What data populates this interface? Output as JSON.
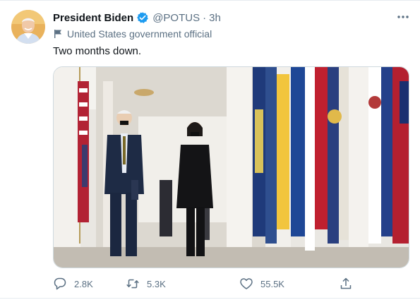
{
  "tweet": {
    "display_name": "President Biden",
    "handle": "@POTUS",
    "separator": "·",
    "time": "3h",
    "label": "United States government official",
    "text": "Two months down."
  },
  "actions": {
    "replies": "2.8K",
    "retweets": "5.3K",
    "likes": "55.5K"
  },
  "colors": {
    "verified": "#1d9bf0",
    "secondary_text": "#5b7083",
    "primary_text": "#0f1419"
  },
  "icons": [
    "verified-badge-icon",
    "flag-icon",
    "more-icon",
    "reply-icon",
    "retweet-icon",
    "like-icon",
    "share-icon"
  ]
}
